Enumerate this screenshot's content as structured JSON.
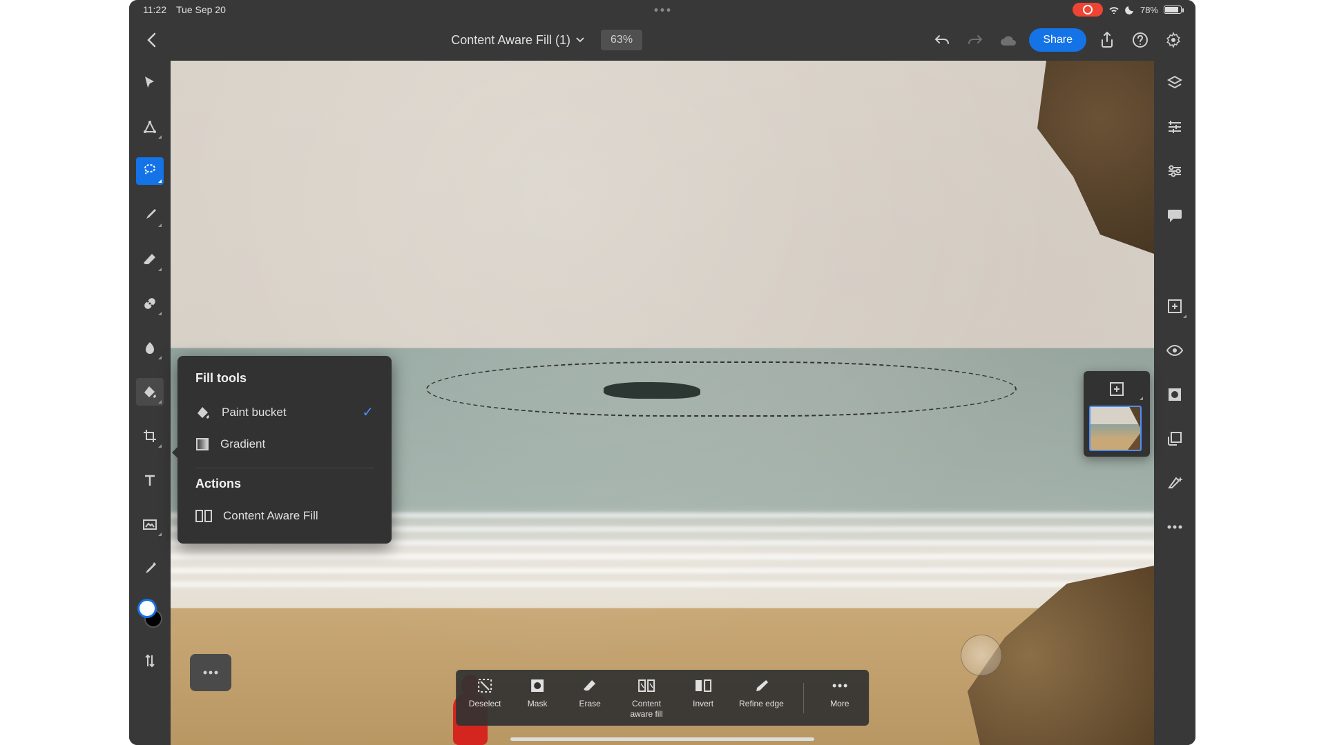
{
  "status": {
    "time": "11:22",
    "date": "Tue Sep 20",
    "battery_pct": "78%"
  },
  "header": {
    "title": "Content Aware Fill (1)",
    "zoom": "63%",
    "share_label": "Share"
  },
  "popover": {
    "title_tools": "Fill tools",
    "paint_bucket": "Paint bucket",
    "gradient": "Gradient",
    "title_actions": "Actions",
    "content_aware": "Content Aware Fill"
  },
  "actions": {
    "deselect": "Deselect",
    "mask": "Mask",
    "erase": "Erase",
    "content_aware_fill": "Content aware fill",
    "invert": "Invert",
    "refine_edge": "Refine edge",
    "more": "More"
  },
  "colors": {
    "accent": "#1473e6"
  }
}
